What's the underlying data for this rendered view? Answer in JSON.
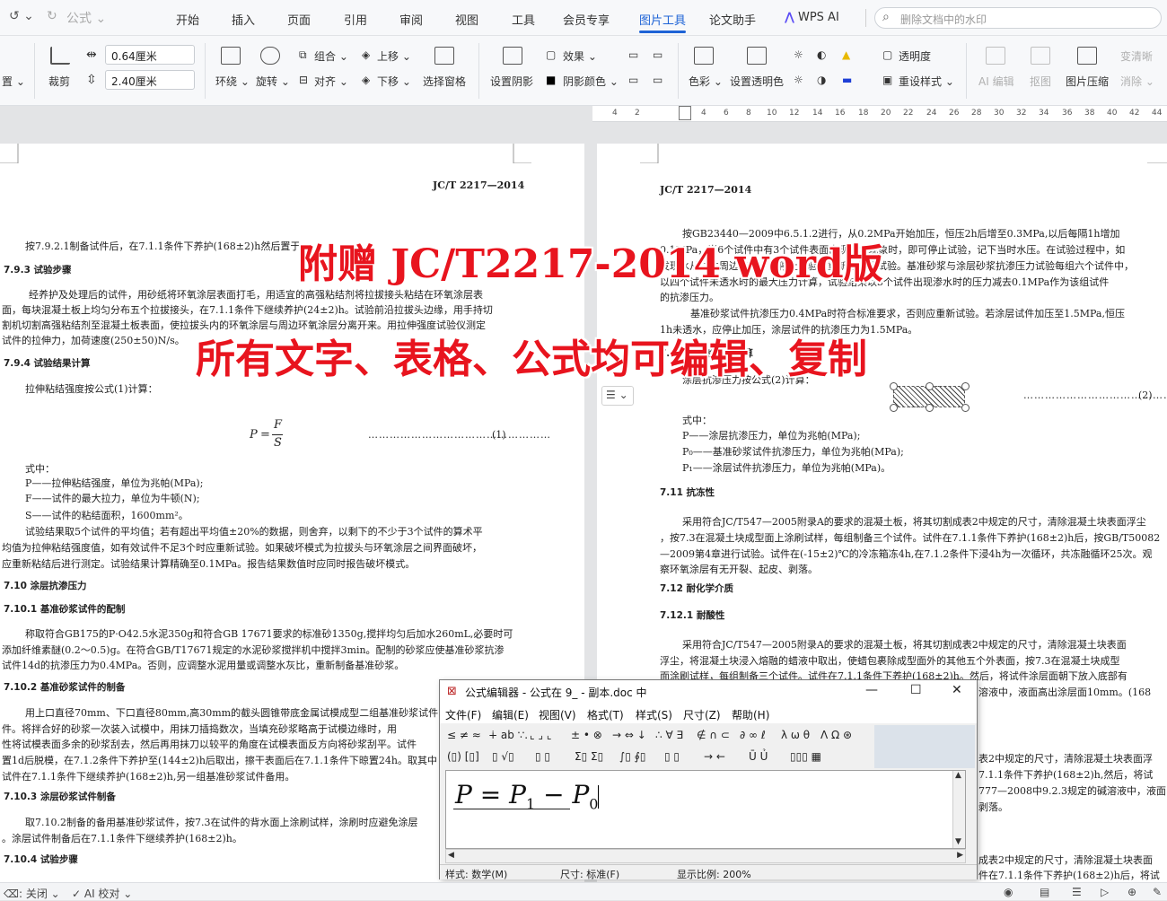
{
  "menu": {
    "quick_access": [
      "↺ ⌄",
      "↻",
      "公式 ⌄"
    ],
    "tabs": [
      "开始",
      "插入",
      "页面",
      "引用",
      "审阅",
      "视图",
      "工具",
      "会员专享",
      "图片工具",
      "论文助手"
    ],
    "active_tab": "图片工具",
    "wps_ai": "WPS AI",
    "search_placeholder": "删除文档中的水印"
  },
  "ribbon": {
    "left_cut_top": "",
    "left_cut_bottom": "置 ⌄",
    "crop": "裁剪",
    "width_value": "0.64厘米",
    "height_value": "2.40厘米",
    "wrap": "环绕 ⌄",
    "rotate": "旋转 ⌄",
    "group": "组合 ⌄",
    "align": "对齐 ⌄",
    "bring_forward": "上移 ⌄",
    "send_backward": "下移 ⌄",
    "selection_pane": "选择窗格",
    "shadow_set": "设置阴影",
    "effect": "效果 ⌄",
    "shadow_color": "阴影颜色 ⌄",
    "color": "色彩 ⌄",
    "set_transparent": "设置透明色",
    "transparency": "透明度",
    "reset_style": "重设样式 ⌄",
    "ai_edit": "AI 编辑",
    "matting": "抠图",
    "compress": "图片压缩",
    "change_clear": "变清晰",
    "erase": "消除 ⌄"
  },
  "ruler": [
    "4",
    "2",
    "",
    "2",
    "4",
    "6",
    "8",
    "10",
    "12",
    "14",
    "16",
    "18",
    "20",
    "22",
    "24",
    "26",
    "28",
    "30",
    "32",
    "34",
    "36",
    "38",
    "40",
    "42",
    "44"
  ],
  "doc_left": {
    "header": "JC/T 2217—2014",
    "lines": [
      {
        "t": "按7.9.2.1制备试件后，在7.1.1条件下养护(168±2)h然后置于",
        "cls": ""
      },
      {
        "t": "7.9.3 试验步骤",
        "cls": "h"
      },
      {
        "t": "经养护及处理后的试件，用砂纸将环氧涂层表面打毛，用适宜的高强粘结剂将拉拔接头粘结在环氧涂层表",
        "cls": ""
      },
      {
        "t": "面，每块混凝土板上均匀分布五个拉拔接头，在7.1.1条件下继续养护(24±2)h。试验前沿拉拔头边缘，用手持切",
        "cls": ""
      },
      {
        "t": "割机切割高强粘结剂至混凝土板表面，使拉拔头内的环氧涂层与周边环氧涂层分离开来。用拉伸强度试验仪测定",
        "cls": ""
      },
      {
        "t": "试件的拉伸力，加荷速度(250±50)N/s。",
        "cls": ""
      },
      {
        "t": "7.9.4 试验结果计算",
        "cls": "h"
      },
      {
        "t": "拉伸粘结强度按公式(1)计算：",
        "cls": ""
      },
      {
        "t": "式中：",
        "cls": ""
      },
      {
        "t": "P——拉伸粘结强度，单位为兆帕(MPa);",
        "cls": ""
      },
      {
        "t": "F——试件的最大拉力，单位为牛顿(N);",
        "cls": ""
      },
      {
        "t": "S——试件的粘结面积，1600mm²。",
        "cls": ""
      },
      {
        "t": "试验结果取5个试件的平均值；若有超出平均值±20%的数据，则舍弃，以剩下的不少于3个试件的算术平",
        "cls": ""
      },
      {
        "t": "均值为拉伸粘结强度值，如有效试件不足3个时应重新试验。如果破坏模式为拉拔头与环氧涂层之间界面破坏，",
        "cls": ""
      },
      {
        "t": "应重新粘结后进行测定。试验结果计算精确至0.1MPa。报告结果数值时应同时报告破坏模式。",
        "cls": ""
      },
      {
        "t": "7.10 涂层抗渗压力",
        "cls": "h"
      },
      {
        "t": "7.10.1 基准砂浆试件的配制",
        "cls": "h"
      },
      {
        "t": "称取符合GB175的P·O42.5水泥350g和符合GB 17671要求的标准砂1350g,搅拌均匀后加水260mL,必要时可",
        "cls": ""
      },
      {
        "t": "添加纤维素醚(0.2～0.5)g。在符合GB/T17671规定的水泥砂浆搅拌机中搅拌3min。配制的砂浆应使基准砂浆抗渗",
        "cls": ""
      },
      {
        "t": "试件14d的抗渗压力为0.4MPa。否则，应调整水泥用量或调整水灰比，重新制备基准砂浆。",
        "cls": ""
      },
      {
        "t": "7.10.2 基准砂浆试件的制备",
        "cls": "h"
      },
      {
        "t": "用上口直径70mm、下口直径80mm,高30mm的截头圆锥带底金属试模成型二组基准砂浆试件",
        "cls": ""
      },
      {
        "t": "件。将拌合好的砂浆一次装入试模中，用抹刀插捣数次，当填充砂浆略高于试模边缘时，用",
        "cls": ""
      },
      {
        "t": "性将试模表面多余的砂浆刮去，然后再用抹刀以较平的角度在试模表面反方向将砂浆刮平。试件",
        "cls": ""
      },
      {
        "t": "置1d后脱模，在7.1.2条件下养护至(144±2)h后取出，擦干表面后在7.1.1条件下晾置24h。取其中",
        "cls": ""
      },
      {
        "t": "试件在7.1.1条件下继续养护(168±2)h,另一组基准砂浆试件备用。",
        "cls": ""
      },
      {
        "t": "7.10.3 涂层砂浆试件制备",
        "cls": "h"
      },
      {
        "t": "取7.10.2制备的备用基准砂浆试件，按7.3在试件的背水面上涂刷试样，涂刷时应避免涂层",
        "cls": ""
      },
      {
        "t": "。涂层试件制备后在7.1.1条件下继续养护(168±2)h。",
        "cls": ""
      },
      {
        "t": "7.10.4 试验步骤",
        "cls": "h"
      }
    ],
    "formula_P": "P",
    "formula_eq": "=",
    "formula_F": "F",
    "formula_S": "S",
    "formula_no": "(1)"
  },
  "doc_right": {
    "header": "JC/T 2217—2014",
    "lines": [
      {
        "t": "按GB23440—2009中6.5.1.2进行，从0.2MPa开始加压，恒压2h后增至0.3MPa,以后每隔1h增加",
        "cls": ""
      },
      {
        "t": "0.1MPa，当6个试件中有3个试件表面出现渗水现象时，即可停止试验，记下当时水压。在试验过程中，如",
        "cls": ""
      },
      {
        "t": "发现水从试件周边渗出，应停止试验，重新密封后试验。基准砂浆与涂层砂浆抗渗压力试验每组六个试件中，",
        "cls": ""
      },
      {
        "t": "以四个试件未透水时的最大压力计算，试验结果以3个试件出现渗水时的压力减去0.1MPa作为该组试件",
        "cls": ""
      },
      {
        "t": "的抗渗压力。",
        "cls": ""
      },
      {
        "t": "基准砂浆试件抗渗压力0.4MPa时符合标准要求，否则应重新试验。若涂层试件加压至1.5MPa,恒压",
        "cls": ""
      },
      {
        "t": "1h未透水，应停止加压，涂层试件的抗渗压力为1.5MPa。",
        "cls": ""
      },
      {
        "t": "7.10.5 试验结果计算",
        "cls": "h"
      },
      {
        "t": "涂层抗渗压力按公式(2)计算：",
        "cls": ""
      },
      {
        "t": "式中：",
        "cls": ""
      },
      {
        "t": "P——涂层抗渗压力，单位为兆帕(MPa);",
        "cls": ""
      },
      {
        "t": "P₀——基准砂浆试件抗渗压力，单位为兆帕(MPa);",
        "cls": ""
      },
      {
        "t": "P₁——涂层试件抗渗压力，单位为兆帕(MPa)。",
        "cls": ""
      },
      {
        "t": "7.11 抗冻性",
        "cls": "h"
      },
      {
        "t": "采用符合JC/T547—2005附录A的要求的混凝土板，将其切割成表2中规定的尺寸，清除混凝土块表面浮尘",
        "cls": ""
      },
      {
        "t": "，按7.3在混凝土块成型面上涂刷试样，每组制备三个试件。试件在7.1.1条件下养护(168±2)h后，按GB/T50082",
        "cls": ""
      },
      {
        "t": "—2009第4章进行试验。试件在(-15±2)℃的冷冻箱冻4h,在7.1.2条件下浸4h为一次循环，共冻融循环25次。观",
        "cls": ""
      },
      {
        "t": "察环氧涂层有无开裂、起皮、剥落。",
        "cls": ""
      },
      {
        "t": "7.12 耐化学介质",
        "cls": "h"
      },
      {
        "t": "7.12.1 耐酸性",
        "cls": "h"
      },
      {
        "t": "采用符合JC/T547—2005附录A的要求的混凝土板，将其切割成表2中规定的尺寸，清除混凝土块表面",
        "cls": ""
      },
      {
        "t": "浮尘，将混凝土块浸入熔融的蜡液中取出，使蜡包裹除成型面外的其他五个外表面，按7.3在混凝土块成型",
        "cls": ""
      },
      {
        "t": "面涂刷试样，每组制备三个试件。试件在7.1.1条件下养护(168±2)h。然后，将试件涂层面朝下放入底部有",
        "cls": ""
      },
      {
        "t": "溶液中，液面高出涂层面10mm。(168",
        "cls": ""
      },
      {
        "t": "表2中规定的尺寸，清除混凝土块表面浮",
        "cls": ""
      },
      {
        "t": "7.1.1条件下养护(168±2)h,然后，将试",
        "cls": ""
      },
      {
        "t": "777—2008中9.2.3规定的碱溶液中，液面",
        "cls": ""
      },
      {
        "t": "剥落。",
        "cls": ""
      },
      {
        "t": "成表2中规定的尺寸，清除混凝土块表面",
        "cls": ""
      },
      {
        "t": "件在7.1.1条件下养护(168±2)h后，将试",
        "cls": ""
      }
    ],
    "formula_no": "(2)"
  },
  "watermark": {
    "line1": "附赠 JC/T2217-2014 word版",
    "line2": "所有文字、表格、公式均可编辑、复制",
    "color": "#e8141e"
  },
  "equation_editor": {
    "title": "公式编辑器 - 公式在 9_ - 副本.doc 中",
    "menus": [
      "文件(F)",
      "编辑(E)",
      "视图(V)",
      "格式(T)",
      "样式(S)",
      "尺寸(Z)",
      "帮助(H)"
    ],
    "palette_row1": [
      "≤ ≠ ≈",
      "∔ ab ∵.",
      "⌞ ⌟ ⌞",
      "± • ⊗",
      "→ ⇔ ↓",
      "∴ ∀ ∃",
      "∉ ∩ ⊂",
      "∂ ∞ ℓ",
      "λ ω θ",
      "Λ Ω ⊛"
    ],
    "palette_row2": [
      "(▯) [▯]",
      "▯ √▯",
      "▯ ▯",
      "Σ▯ Σ▯",
      "∫▯ ∮▯",
      "▯ ▯",
      "→ ←",
      "Ū Ủ",
      "▯▯▯ ▦"
    ],
    "formula_lhs": "P",
    "formula_eq": "=",
    "formula_p1": "P",
    "formula_sub1": "1",
    "formula_minus": "−",
    "formula_p0": "P",
    "formula_sub0": "0",
    "status_style": "样式:  数学(M)",
    "status_size": "尺寸:  标准(F)",
    "status_zoom": "显示比例:  200%"
  },
  "statusbar": {
    "left1": "⌫: 关闭 ⌄",
    "left2": "✓ AI 校对 ⌄"
  }
}
